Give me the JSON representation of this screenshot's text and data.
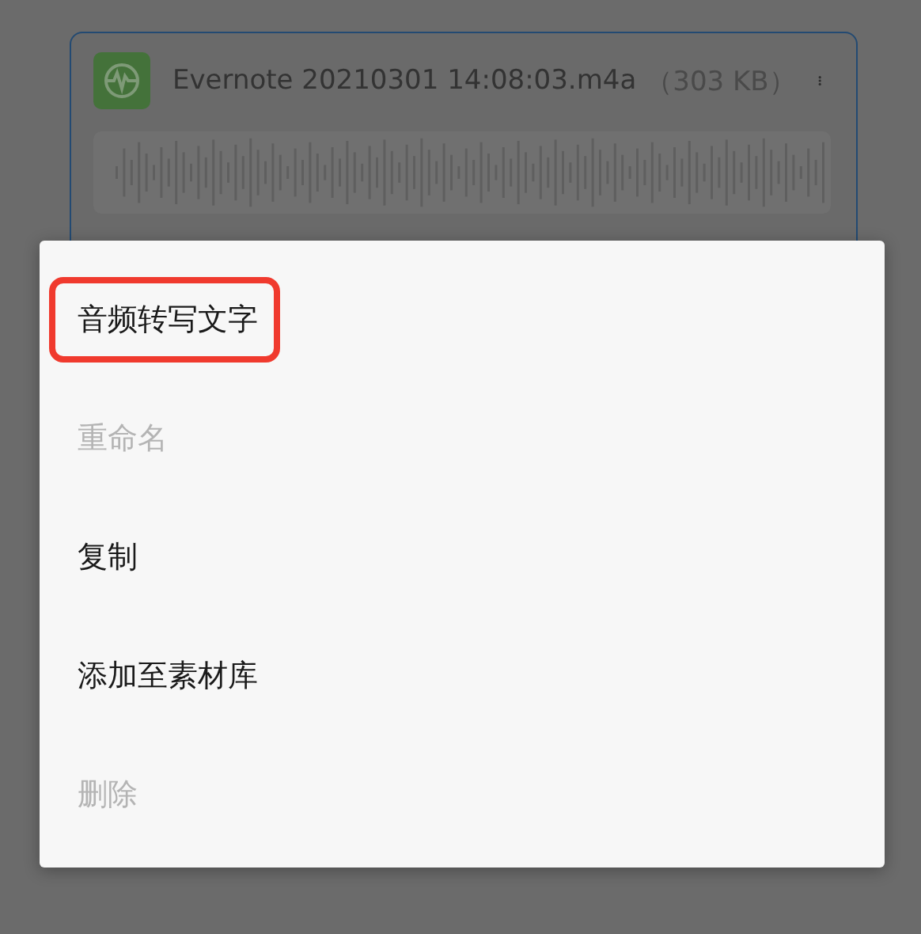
{
  "attachment": {
    "filename": "Evernote 20210301 14:08:03.m4a",
    "size": "（303 KB）"
  },
  "menu": {
    "items": [
      {
        "label": "音频转写文字",
        "disabled": false,
        "highlighted": true
      },
      {
        "label": "重命名",
        "disabled": true,
        "highlighted": false
      },
      {
        "label": "复制",
        "disabled": false,
        "highlighted": false
      },
      {
        "label": "添加至素材库",
        "disabled": false,
        "highlighted": false
      },
      {
        "label": "删除",
        "disabled": true,
        "highlighted": false
      }
    ]
  }
}
